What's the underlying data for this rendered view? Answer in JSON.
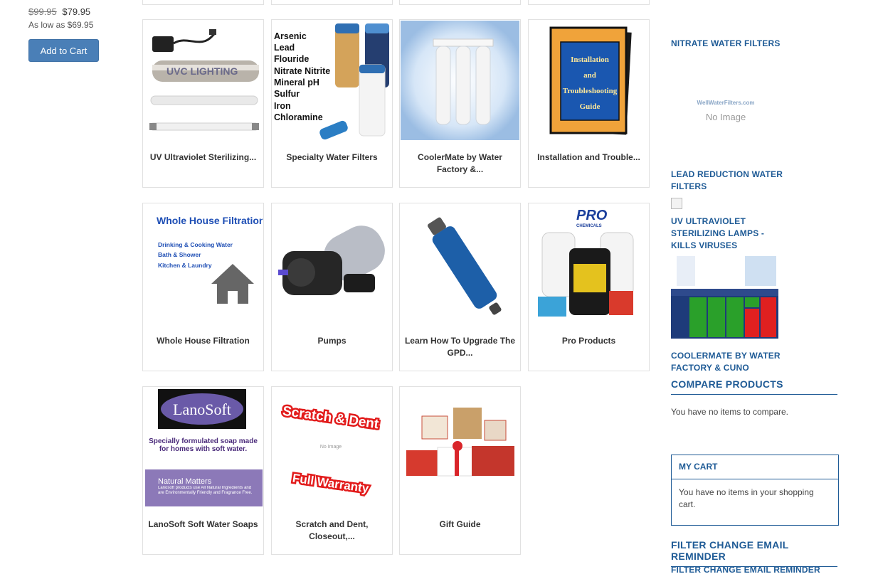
{
  "product": {
    "old_price": "$99.95",
    "new_price": "$79.95",
    "as_low_as": "As low as $69.95",
    "add_to_cart": "Add to Cart"
  },
  "categories": [
    {
      "label": "UV Ultraviolet Sterilizing...",
      "image_text": "UVC LIGHTING"
    },
    {
      "label": "Specialty Water Filters",
      "image_lines": [
        "Arsenic",
        "Lead",
        "Flouride",
        "Nitrate Nitrite",
        "Mineral pH",
        "Sulfur",
        "Iron",
        "Chloramine"
      ]
    },
    {
      "label": "CoolerMate by Water Factory &..."
    },
    {
      "label": "Installation and Trouble...",
      "image_lines": [
        "Installation",
        "and",
        "Troubleshooting",
        "Guide"
      ]
    },
    {
      "label": "Whole House Filtration",
      "image_title": "Whole House Filtration",
      "image_lines": [
        "Drinking & Cooking Water",
        "Bath & Shower",
        "Kitchen & Laundry"
      ]
    },
    {
      "label": "Pumps"
    },
    {
      "label": "Learn How To Upgrade The GPD..."
    },
    {
      "label": "Pro Products",
      "image_logo": "PRO",
      "image_logo_sub": "CHEMICALS"
    },
    {
      "label": "LanoSoft Soft Water Soaps",
      "image_logo": "LanoSoft",
      "image_tagline": "Specially formulated soap made for homes with soft water.",
      "image_box_title": "Natural Matters",
      "image_box_text": "Lanosoft products use All Natural Ingredients and are Environmentally Friendly and Fragrance Free."
    },
    {
      "label": "Scratch and Dent, Closeout,...",
      "image_top": "Scratch & Dent",
      "image_bottom": "Full Warranty",
      "image_noimg": "No Image"
    },
    {
      "label": "Gift Guide"
    }
  ],
  "sidebar": {
    "links": [
      "NITRATE WATER FILTERS",
      "LEAD REDUCTION WATER FILTERS",
      "UV ULTRAVIOLET STERILIZING LAMPS - KILLS VIRUSES",
      "COOLERMATE BY WATER FACTORY & CUNO"
    ],
    "no_image_brand": "WellWaterFilters.com",
    "no_image_text": "No Image",
    "compare_heading": "COMPARE PRODUCTS",
    "compare_text": "You have no items to compare.",
    "cart_title": "MY CART",
    "cart_text": "You have no items in your shopping cart.",
    "reminder_heading": "FILTER CHANGE EMAIL REMINDER",
    "reminder_link": "FILTER CHANGE EMAIL REMINDER"
  },
  "colors": {
    "link": "#1f5b96",
    "button": "#4a7fb7"
  }
}
